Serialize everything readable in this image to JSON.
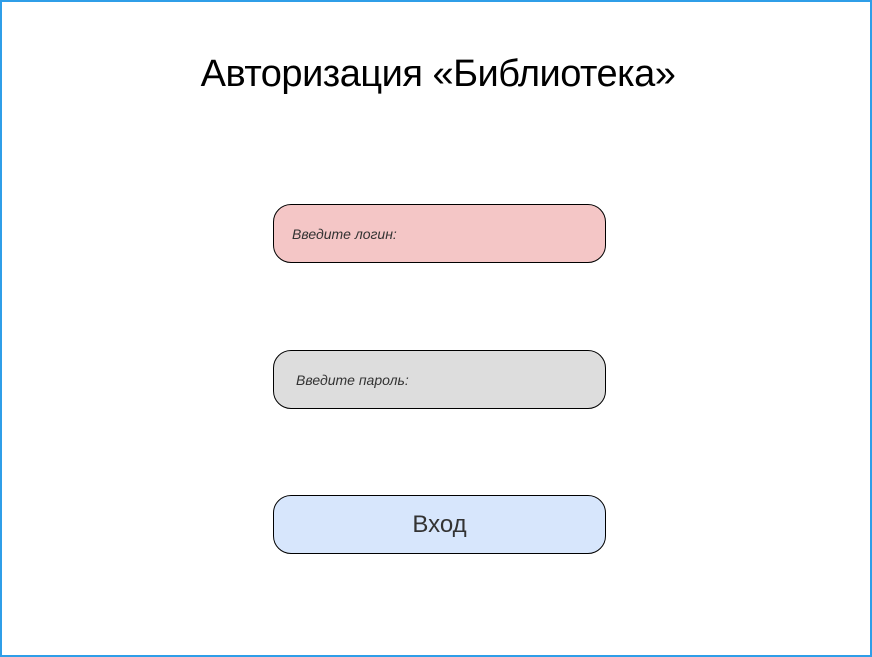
{
  "page": {
    "title": "Авторизация «Библиотека»"
  },
  "login": {
    "placeholder": "Введите логин:",
    "value": ""
  },
  "password": {
    "placeholder": "Введите пароль:",
    "value": ""
  },
  "submit": {
    "label": "Вход"
  },
  "colors": {
    "frame_border": "#2f9ee8",
    "login_bg": "#f4c6c6",
    "password_bg": "#dddddd",
    "button_bg": "#d7e6fc"
  }
}
